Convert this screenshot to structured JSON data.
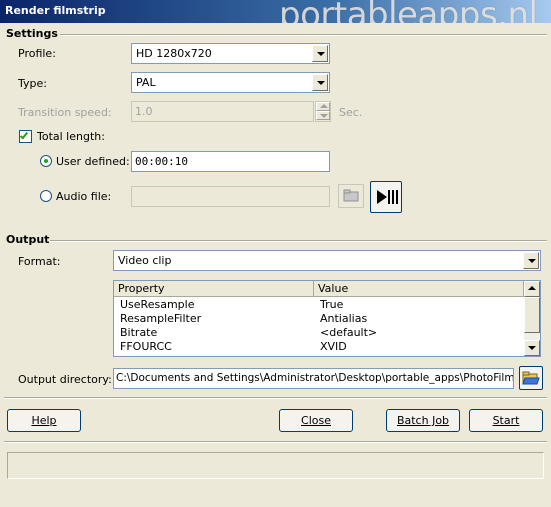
{
  "window": {
    "title": "Render filmstrip",
    "watermark": "portableapps.nl"
  },
  "settings": {
    "group_title": "Settings",
    "profile_label": "Profile:",
    "profile_value": "HD 1280x720",
    "type_label": "Type:",
    "type_value": "PAL",
    "transition_label": "Transition speed:",
    "transition_value": "1.0",
    "transition_unit": "Sec.",
    "total_length_label": "Total length:",
    "total_length_checked": true,
    "user_defined_label": "User defined:",
    "user_defined_value": "00:00:10",
    "audio_file_label": "Audio file:",
    "audio_file_value": "",
    "browse_icon": "folder-browse-icon",
    "play_icon": "play-to-end-icon"
  },
  "output": {
    "group_title": "Output",
    "format_label": "Format:",
    "format_value": "Video clip",
    "grid": {
      "columns": [
        "Property",
        "Value"
      ],
      "rows": [
        {
          "property": "UseResample",
          "value": "True"
        },
        {
          "property": "ResampleFilter",
          "value": "Antialias"
        },
        {
          "property": "Bitrate",
          "value": "<default>"
        },
        {
          "property": "FFOURCC",
          "value": "XVID"
        }
      ]
    },
    "directory_label": "Output directory:",
    "directory_value": "C:\\Documents and Settings\\Administrator\\Desktop\\portable_apps\\PhotoFilmStrip\\E",
    "folder_icon": "open-folder-icon"
  },
  "buttons": {
    "help": "Help",
    "close": "Close",
    "batch_job": "Batch Job",
    "start": "Start"
  },
  "status": {
    "text": ""
  },
  "colors": {
    "title_bar": "#0a246a",
    "dialog_bg": "#ece9d8",
    "field_border": "#7f9db9"
  }
}
